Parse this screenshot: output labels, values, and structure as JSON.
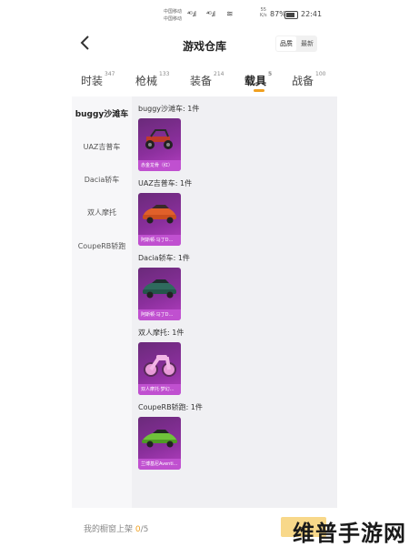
{
  "status_bar": {
    "carrier_line1": "中国移动",
    "carrier_line2": "中国移动",
    "signal_a": "⁴ᴳ.ıl",
    "signal_b": "⁴ᴳ.ıl",
    "wifi": "≋",
    "speed_value": "55",
    "speed_unit": "K/s",
    "battery": "87%",
    "time": "22:41"
  },
  "header": {
    "back_icon": "chevron-left-icon",
    "title": "游戏仓库",
    "toggle_quality": "品质",
    "toggle_latest": "最新"
  },
  "tabs": [
    {
      "label": "时装",
      "count": "347"
    },
    {
      "label": "枪械",
      "count": "133"
    },
    {
      "label": "装备",
      "count": "214"
    },
    {
      "label": "载具",
      "count": "5"
    },
    {
      "label": "战备",
      "count": "100"
    }
  ],
  "sidebar": {
    "items": [
      {
        "label": "buggy沙滩车"
      },
      {
        "label": "UAZ吉普车"
      },
      {
        "label": "Dacia轿车"
      },
      {
        "label": "双人摩托"
      },
      {
        "label": "CoupeRB轿跑"
      }
    ]
  },
  "sections": [
    {
      "title": "buggy沙滩车: 1件",
      "card_label": "赤金龙骨（红）",
      "art": "buggy"
    },
    {
      "title": "UAZ吉普车: 1件",
      "card_label": "阿斯顿·马丁D…",
      "art": "car-orange"
    },
    {
      "title": "Dacia轿车: 1件",
      "card_label": "阿斯顿·马丁D…",
      "art": "car-teal"
    },
    {
      "title": "双人摩托: 1件",
      "card_label": "双人摩托·梦幻…",
      "art": "moto-pink"
    },
    {
      "title": "CoupeRB轿跑: 1件",
      "card_label": "兰博基尼Aventi…",
      "art": "car-green"
    }
  ],
  "footer": {
    "prefix": "我的橱窗上架",
    "current": "0",
    "total": "/5"
  },
  "watermark": "维普手游网",
  "colors": {
    "accent": "#f0a020",
    "card_purple": "#8a2f9c",
    "card_label": "#c050d0"
  }
}
